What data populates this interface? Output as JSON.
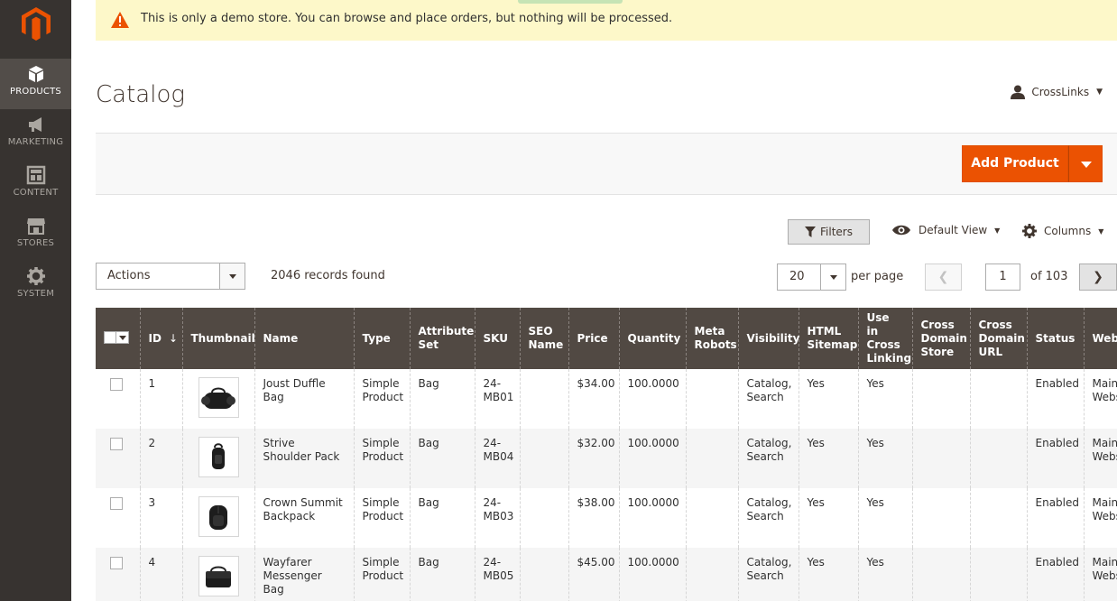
{
  "sidebar": {
    "items": [
      {
        "label": "PRODUCTS",
        "icon": "box-icon",
        "active": true
      },
      {
        "label": "MARKETING",
        "icon": "megaphone-icon"
      },
      {
        "label": "CONTENT",
        "icon": "layout-icon"
      },
      {
        "label": "STORES",
        "icon": "store-icon"
      },
      {
        "label": "SYSTEM",
        "icon": "gear-icon"
      }
    ]
  },
  "notice": {
    "text": "This is only a demo store. You can browse and place orders, but nothing will be processed."
  },
  "header": {
    "title": "Catalog",
    "user": "CrossLinks"
  },
  "toolbar": {
    "add_label": "Add Product"
  },
  "grid_controls": {
    "filters_label": "Filters",
    "view_label": "Default View",
    "columns_label": "Columns",
    "actions_label": "Actions",
    "records_text": "2046 records found",
    "per_page_value": "20",
    "per_page_label": "per page",
    "page_value": "1",
    "page_of": "of 103"
  },
  "table": {
    "headers": [
      "ID",
      "Thumbnail",
      "Name",
      "Type",
      "Attribute Set",
      "SKU",
      "SEO Name",
      "Price",
      "Quantity",
      "Meta Robots",
      "Visibility",
      "HTML Sitemap",
      "Use in Cross Linking",
      "Cross Domain Store",
      "Cross Domain URL",
      "Status",
      "Websites"
    ],
    "rows": [
      {
        "id": "1",
        "name": "Joust Duffle Bag",
        "type": "Simple Product",
        "attr": "Bag",
        "sku": "24-MB01",
        "seo": "",
        "price": "$34.00",
        "qty": "100.0000",
        "robots": "",
        "visibility": "Catalog, Search",
        "sitemap": "Yes",
        "crosslink": "Yes",
        "cds": "",
        "cdu": "",
        "status": "Enabled",
        "websites": "Main Website"
      },
      {
        "id": "2",
        "name": "Strive Shoulder Pack",
        "type": "Simple Product",
        "attr": "Bag",
        "sku": "24-MB04",
        "seo": "",
        "price": "$32.00",
        "qty": "100.0000",
        "robots": "",
        "visibility": "Catalog, Search",
        "sitemap": "Yes",
        "crosslink": "Yes",
        "cds": "",
        "cdu": "",
        "status": "Enabled",
        "websites": "Main Website"
      },
      {
        "id": "3",
        "name": "Crown Summit Backpack",
        "type": "Simple Product",
        "attr": "Bag",
        "sku": "24-MB03",
        "seo": "",
        "price": "$38.00",
        "qty": "100.0000",
        "robots": "",
        "visibility": "Catalog, Search",
        "sitemap": "Yes",
        "crosslink": "Yes",
        "cds": "",
        "cdu": "",
        "status": "Enabled",
        "websites": "Main Website"
      },
      {
        "id": "4",
        "name": "Wayfarer Messenger Bag",
        "type": "Simple Product",
        "attr": "Bag",
        "sku": "24-MB05",
        "seo": "",
        "price": "$45.00",
        "qty": "100.0000",
        "robots": "",
        "visibility": "Catalog, Search",
        "sitemap": "Yes",
        "crosslink": "Yes",
        "cds": "",
        "cdu": "",
        "status": "Enabled",
        "websites": "Main Website"
      }
    ]
  },
  "colors": {
    "accent": "#eb5202",
    "sidebar": "#373330",
    "table_header": "#514943",
    "notice_bg": "#fdf8c9"
  }
}
